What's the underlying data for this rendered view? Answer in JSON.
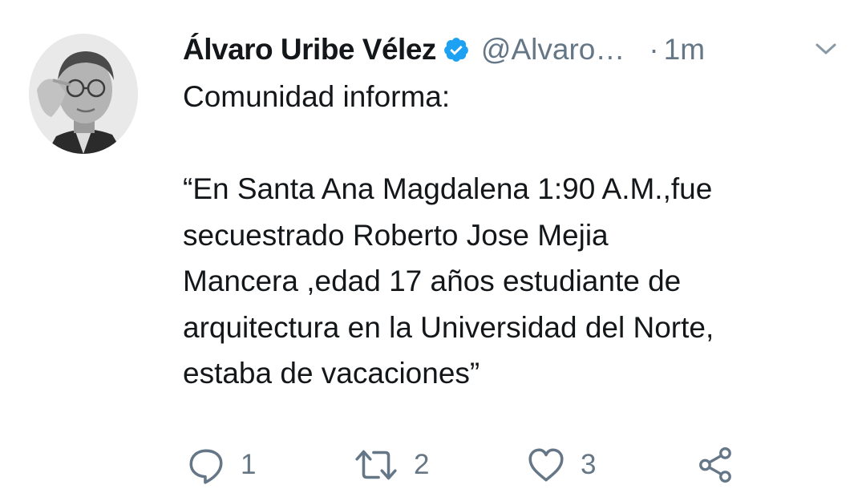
{
  "tweet": {
    "display_name": "Álvaro Uribe Vélez",
    "verified_icon": "verified-badge-icon",
    "handle": "@Alvaro…",
    "separator": "·",
    "time": "1m",
    "menu_icon": "chevron-down-icon",
    "text": "Comunidad informa:\n\n“En Santa Ana Magdalena 1:90 A.M.,fue\nsecuestrado Roberto  Jose Mejia\nMancera ,edad 17 años estudiante de\narquitectura en la Universidad del Norte,\nestaba de vacaciones”"
  },
  "actions": {
    "reply": {
      "icon": "reply-icon",
      "count": "1"
    },
    "retweet": {
      "icon": "retweet-icon",
      "count": "2"
    },
    "like": {
      "icon": "heart-icon",
      "count": "3"
    },
    "share": {
      "icon": "share-icon"
    }
  },
  "colors": {
    "text": "#14171a",
    "secondary": "#657786",
    "verified": "#1da1f2",
    "background": "#ffffff"
  }
}
